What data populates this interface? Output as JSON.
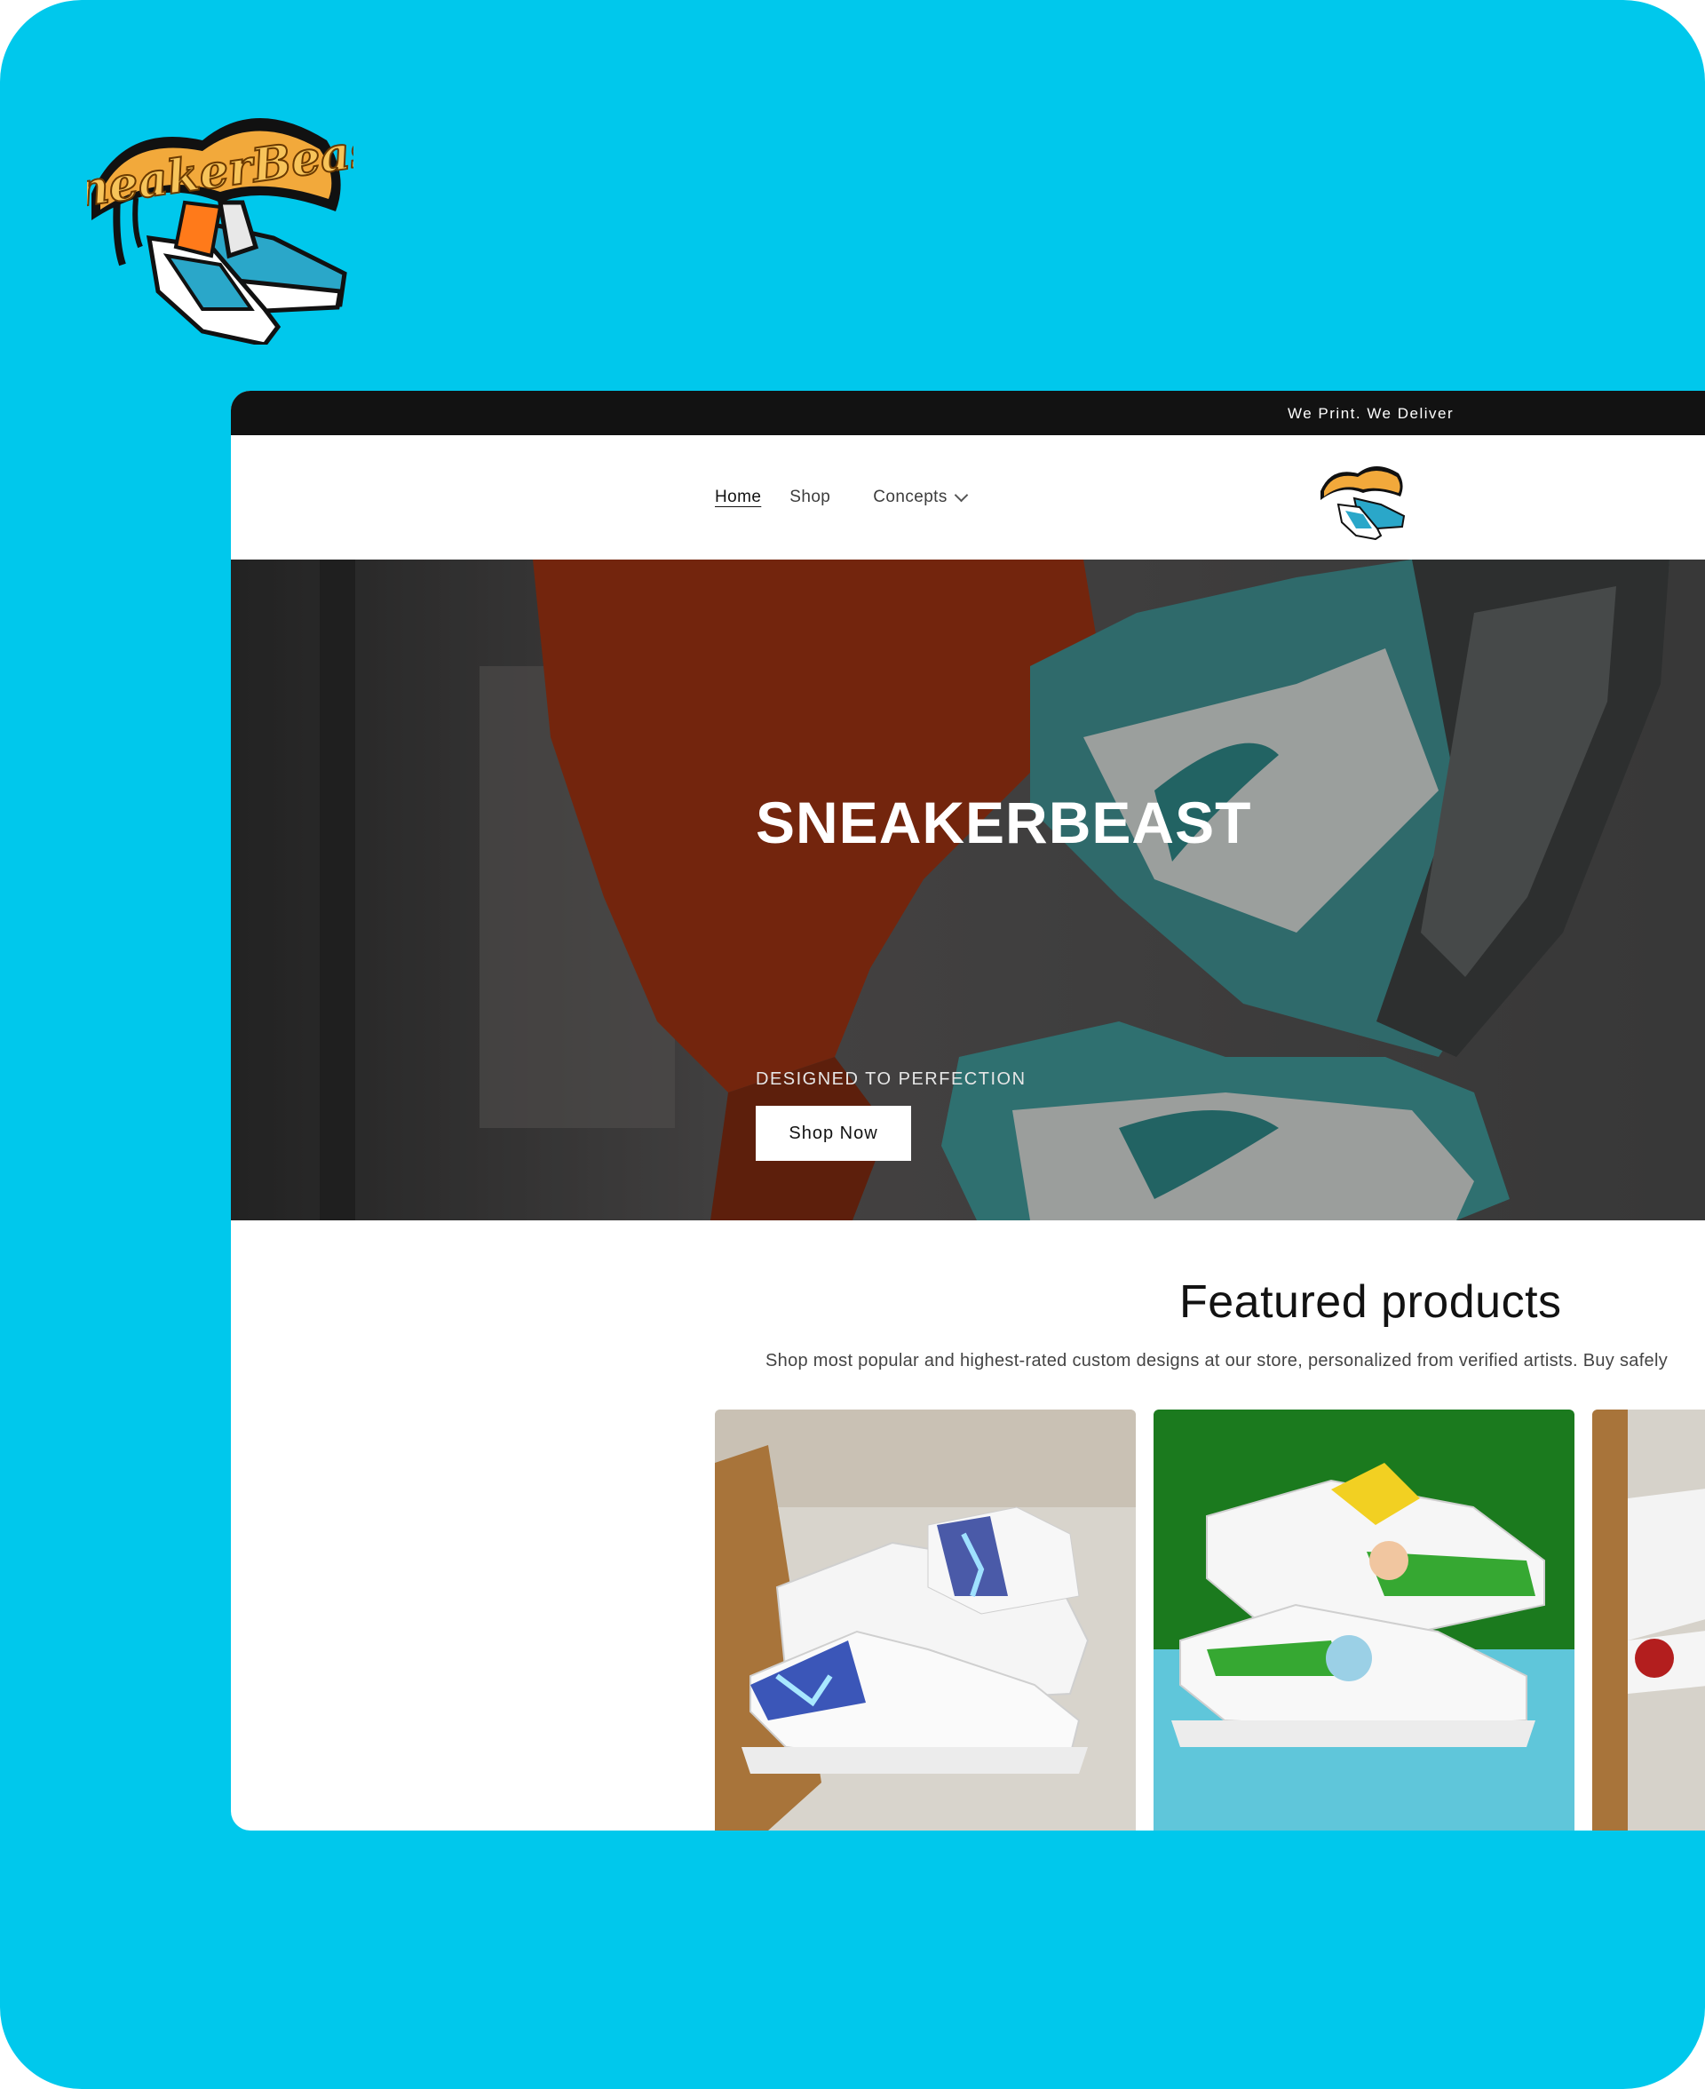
{
  "brand": {
    "logo_text": "SneakerBeast"
  },
  "announcement": {
    "text": "We Print. We Deliver"
  },
  "nav": {
    "items": [
      {
        "label": "Home"
      },
      {
        "label": "Shop"
      },
      {
        "label": "Concepts"
      }
    ]
  },
  "hero": {
    "title": "SNEAKERBEAST",
    "subtitle": "DESIGNED TO PERFECTION",
    "cta_label": "Shop Now"
  },
  "featured": {
    "title": "Featured products",
    "subtitle": "Shop most popular and highest-rated custom designs at our store, personalized from verified artists. Buy safely"
  },
  "colors": {
    "background": "#00c8ec",
    "announcement_bar": "#121212",
    "accent_gold": "#f2a93b"
  }
}
